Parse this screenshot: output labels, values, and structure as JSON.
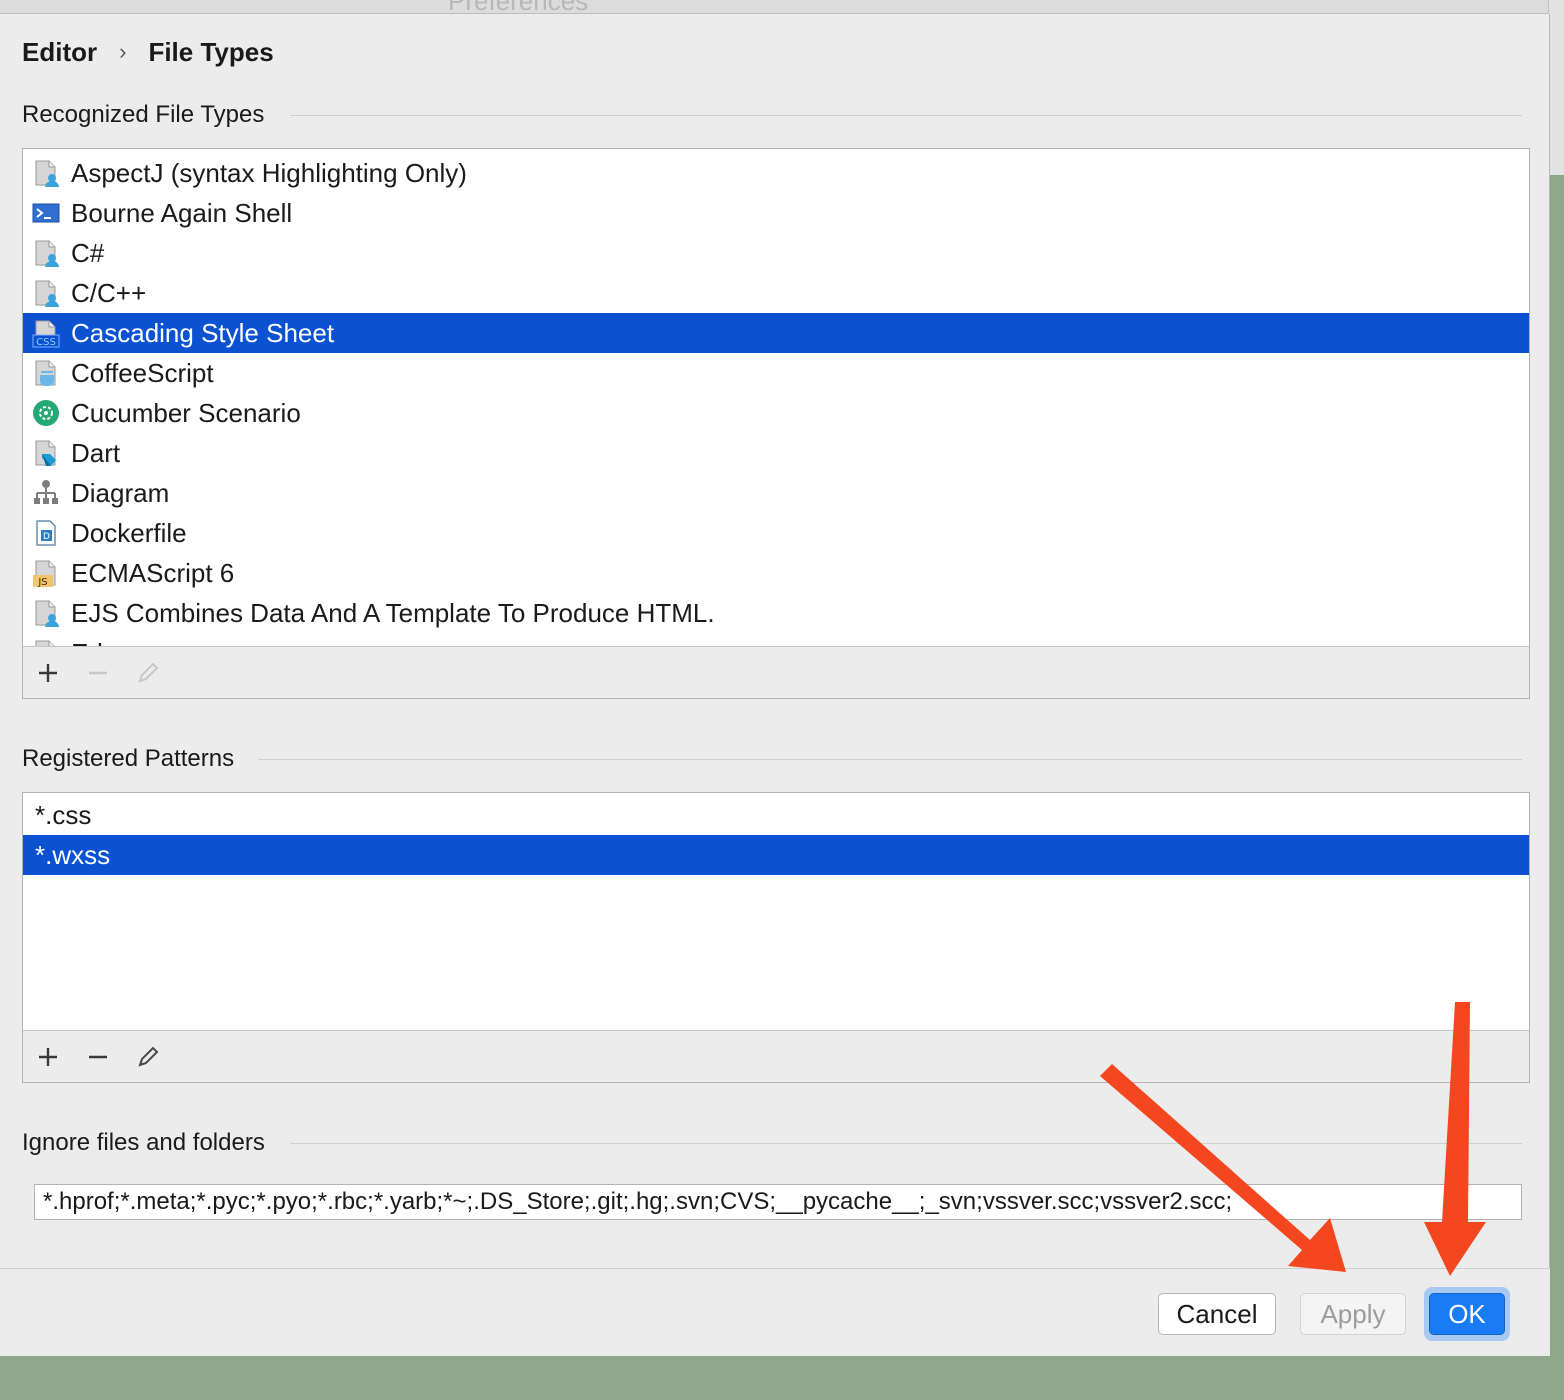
{
  "window": {
    "title": "Preferences"
  },
  "breadcrumb": {
    "parent": "Editor",
    "separator": "›",
    "current": "File Types"
  },
  "recognized": {
    "title": "Recognized File Types",
    "items": [
      {
        "label": "AspectJ (syntax Highlighting Only)",
        "icon": "generic-file-icon"
      },
      {
        "label": "Bourne Again Shell",
        "icon": "terminal-icon"
      },
      {
        "label": "C#",
        "icon": "generic-file-icon"
      },
      {
        "label": "C/C++",
        "icon": "generic-file-icon"
      },
      {
        "label": "Cascading Style Sheet",
        "icon": "css-file-icon",
        "selected": true
      },
      {
        "label": "CoffeeScript",
        "icon": "coffee-file-icon"
      },
      {
        "label": "Cucumber Scenario",
        "icon": "cucumber-icon"
      },
      {
        "label": "Dart",
        "icon": "dart-file-icon"
      },
      {
        "label": "Diagram",
        "icon": "diagram-icon"
      },
      {
        "label": "Dockerfile",
        "icon": "docker-file-icon"
      },
      {
        "label": "ECMAScript 6",
        "icon": "js-file-icon"
      },
      {
        "label": "EJS Combines Data And A Template To Produce HTML.",
        "icon": "generic-file-icon"
      },
      {
        "label": "Erb",
        "icon": "generic-file-icon"
      }
    ]
  },
  "patterns": {
    "title": "Registered Patterns",
    "items": [
      {
        "label": "*.css"
      },
      {
        "label": "*.wxss",
        "selected": true
      }
    ]
  },
  "ignore": {
    "title": "Ignore files and folders",
    "value": "*.hprof;*.meta;*.pyc;*.pyo;*.rbc;*.yarb;*~;.DS_Store;.git;.hg;.svn;CVS;__pycache__;_svn;vssver.scc;vssver2.scc;"
  },
  "buttons": {
    "cancel": "Cancel",
    "apply": "Apply",
    "ok": "OK"
  },
  "colors": {
    "selection": "#0a52d1",
    "ok_button": "#1a7cf5",
    "annotation_arrow": "#f4471f"
  }
}
